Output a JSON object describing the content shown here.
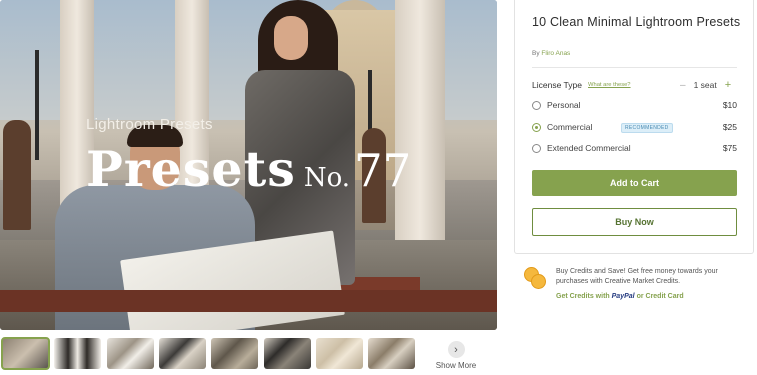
{
  "hero": {
    "subtitle": "Lightroom Presets",
    "title_main": "Presets",
    "title_no": "No.",
    "title_num": "77"
  },
  "thumbnails": {
    "count": 8,
    "active_index": 0,
    "show_more_label": "Show More"
  },
  "product": {
    "title": "10 Clean Minimal Lightroom Presets",
    "by_prefix": "By",
    "author": "Fliro Anas"
  },
  "license": {
    "label": "License Type",
    "help_link": "What are these?",
    "seats": "1 seat",
    "options": [
      {
        "name": "Personal",
        "price": "$10",
        "selected": false
      },
      {
        "name": "Commercial",
        "price": "$25",
        "selected": true,
        "badge": "RECOMMENDED"
      },
      {
        "name": "Extended Commercial",
        "price": "$75",
        "selected": false
      }
    ]
  },
  "actions": {
    "add_to_cart": "Add to Cart",
    "buy_now": "Buy Now"
  },
  "credits": {
    "text": "Buy Credits and Save! Get free money towards your purchases with Creative Market Credits.",
    "link_prefix": "Get Credits with",
    "paypal": "PayPal",
    "link_suffix": "or Credit Card"
  },
  "colors": {
    "accent": "#86a24e",
    "badge": "#4a8bb3"
  }
}
